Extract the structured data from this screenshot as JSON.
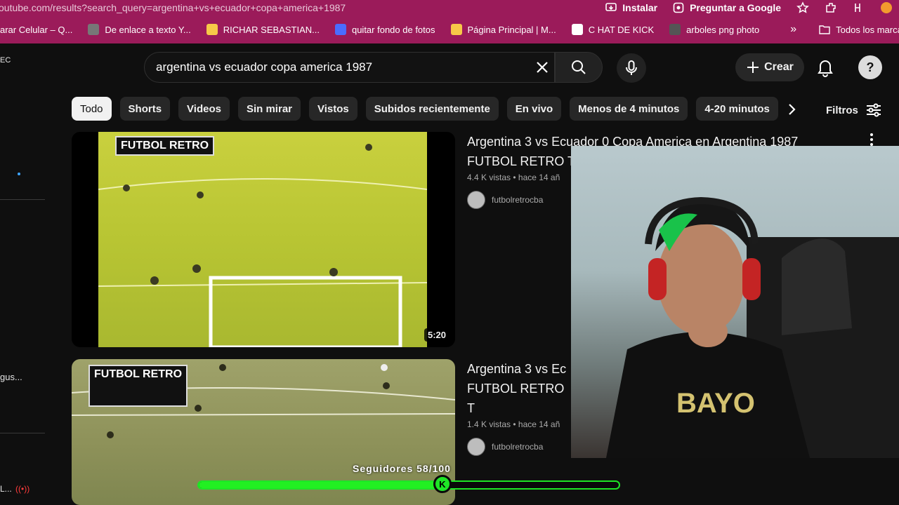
{
  "browser": {
    "url": "outube.com/results?search_query=argentina+vs+ecuador+copa+america+1987",
    "install_label": "Instalar",
    "ask_google_label": "Preguntar a Google"
  },
  "bookmarks": [
    {
      "label": "arar Celular – Q...",
      "color": "#ffffff"
    },
    {
      "label": "De enlace a texto Y...",
      "color": "#777777"
    },
    {
      "label": "RICHAR SEBASTIAN...",
      "color": "#f7c948"
    },
    {
      "label": "quitar fondo de fotos",
      "color": "#4a6cff"
    },
    {
      "label": "Página Principal | M...",
      "color": "#f7c948"
    },
    {
      "label": "C HAT DE KICK",
      "color": "#ffffff"
    },
    {
      "label": "arboles png photo",
      "color": "#555555"
    }
  ],
  "bookmarks_overflow": "»",
  "bookmarks_all": "Todos los marcadores",
  "rail": {
    "top_label": "EC",
    "label_1": "gus...",
    "label_2": "L..."
  },
  "search": {
    "query": "argentina vs ecuador copa america 1987"
  },
  "header": {
    "create_label": "Crear"
  },
  "chips": [
    "Todo",
    "Shorts",
    "Videos",
    "Sin mirar",
    "Vistos",
    "Subidos recientemente",
    "En vivo",
    "Menos de 4 minutos",
    "4-20 minutos"
  ],
  "filters_label": "Filtros",
  "videos": [
    {
      "title": "Argentina 3 vs Ecuador 0 Copa America en Argentina 1987 FUTBOL RETRO T",
      "meta": "4.4 K vistas • hace 14 añ",
      "channel": "futbolretrocba",
      "duration": "5:20",
      "logo_text": "FUTBOL RETRO"
    },
    {
      "title": "Argentina 3 vs Ec FUTBOL RETRO T",
      "meta": "1.4 K vistas • hace 14 añ",
      "channel": "futbolretrocba",
      "logo_text": "FUTBOL RETRO"
    }
  ],
  "overlay": {
    "followers_label": "Seguidores 58/100",
    "followers_current": 58,
    "followers_goal": 100,
    "knob_letter": "K",
    "accent": "#1ee626"
  }
}
